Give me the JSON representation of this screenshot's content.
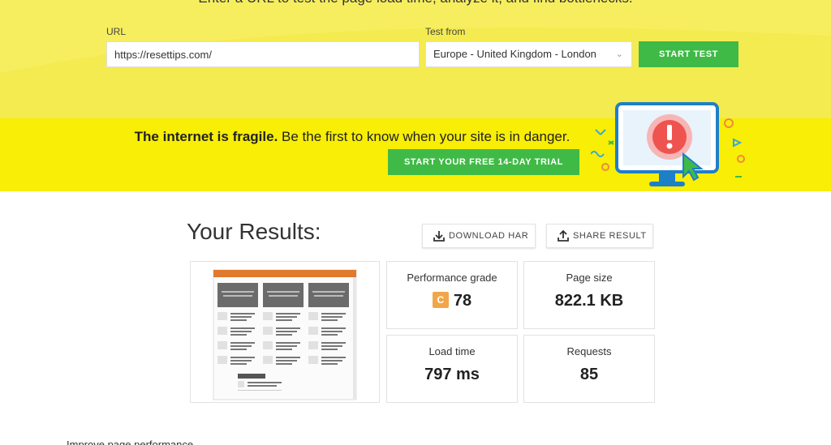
{
  "header": {
    "intro": "Enter a URL to test the page load time, analyze it, and find bottlenecks."
  },
  "form": {
    "url_label": "URL",
    "url_value": "https://resettips.com/",
    "location_label": "Test from",
    "location_value": "Europe - United Kingdom - London",
    "start_test": "START TEST"
  },
  "banner": {
    "bold": "The internet is fragile.",
    "text": " Be the first to know when your site is in danger.",
    "cta": "START YOUR FREE 14-DAY TRIAL"
  },
  "results": {
    "title": "Your Results:",
    "download_har": "DOWNLOAD HAR",
    "share_result": "SHARE RESULT",
    "performance_label": "Performance grade",
    "grade_letter": "C",
    "grade_value": "78",
    "page_size_label": "Page size",
    "page_size_value": "822.1 KB",
    "load_time_label": "Load time",
    "load_time_value": "797 ms",
    "requests_label": "Requests",
    "requests_value": "85"
  },
  "improve": "Improve page performance",
  "colors": {
    "top_yellow": "#f6ee5f",
    "banner_yellow": "#f8ee06",
    "green": "#3fba46",
    "grade_orange": "#f2a64a"
  }
}
